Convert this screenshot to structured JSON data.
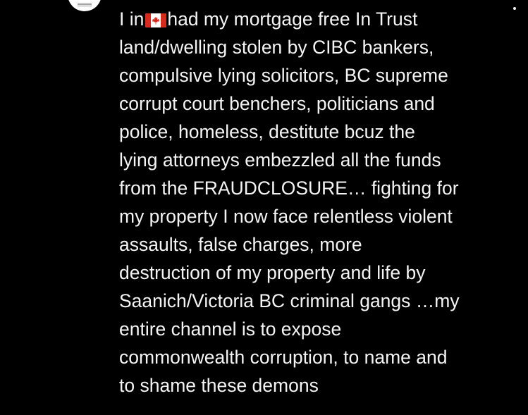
{
  "comment": {
    "lines": [
      {
        "before_flag": "I in",
        "flag_icon": "canada-flag-icon",
        "after_flag": "had my mortgage free In Trust"
      },
      "land/dwelling stolen by CIBC bankers,",
      "compulsive lying solicitors, BC supreme",
      "corrupt court benchers, politicians and",
      "police, homeless, destitute bcuz the",
      "lying attorneys embezzled all the funds",
      "from the FRAUDCLOSURE… fighting for",
      "my property I now face relentless violent",
      "assaults, false charges, more",
      "destruction of my property and life by",
      "Saanich/Victoria BC criminal gangs …my",
      "entire channel is to expose",
      "commonwealth corruption, to name and",
      "to shame these demons"
    ]
  },
  "icons": {
    "more_menu": "more-vertical-icon",
    "avatar": "channel-avatar"
  },
  "colors": {
    "background": "#000000",
    "text": "#f4f4f4",
    "flag_red": "#d52b1e",
    "flag_white": "#ffffff"
  }
}
